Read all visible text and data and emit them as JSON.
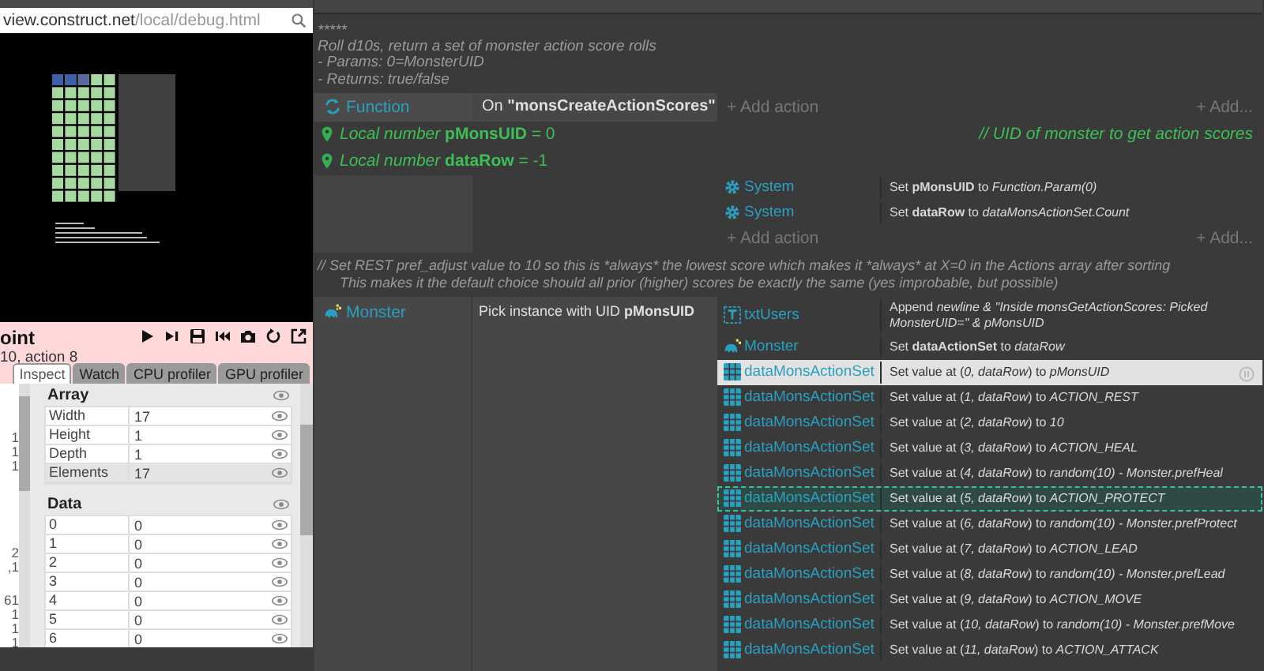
{
  "preview": {
    "address_host": "view.construct.net",
    "address_path": "/local/debug.html"
  },
  "debugger": {
    "title": "oint",
    "subtitle": "10, action 8",
    "tabs": [
      {
        "label": "Inspect",
        "selected": true
      },
      {
        "label": "Watch",
        "selected": false
      },
      {
        "label": "CPU profiler",
        "selected": false
      },
      {
        "label": "GPU profiler",
        "selected": false
      }
    ],
    "left_column": [
      [
        "1",
        "1",
        "1"
      ],
      [
        "2",
        ",1"
      ],
      [
        "61",
        "1",
        "1",
        "1"
      ]
    ],
    "sections": [
      {
        "title": "Array",
        "rows": [
          {
            "name": "Width",
            "value": "17",
            "selected": false
          },
          {
            "name": "Height",
            "value": "1",
            "selected": false
          },
          {
            "name": "Depth",
            "value": "1",
            "selected": false
          },
          {
            "name": "Elements",
            "value": "17",
            "selected": true
          }
        ]
      },
      {
        "title": "Data",
        "rows": [
          {
            "name": "0",
            "value": "0",
            "selected": false
          },
          {
            "name": "1",
            "value": "0",
            "selected": false
          },
          {
            "name": "2",
            "value": "0",
            "selected": false
          },
          {
            "name": "3",
            "value": "0",
            "selected": false
          },
          {
            "name": "4",
            "value": "0",
            "selected": false
          },
          {
            "name": "5",
            "value": "0",
            "selected": false
          },
          {
            "name": "6",
            "value": "0",
            "selected": false
          }
        ]
      }
    ]
  },
  "event_sheet": {
    "comment_top": [
      "*****",
      "Roll d10s, return a set of monster action score rolls",
      "- Params: 0=MonsterUID",
      "- Returns: true/false"
    ],
    "function_event": {
      "object": "Function",
      "condition": "On **\"monsCreateActionScores\"**",
      "add_action": "+ Add action",
      "add": "+ Add..."
    },
    "local_vars": [
      {
        "text": "*Local number* **pMonsUID** = 0",
        "comment": "//  UID of monster to get action scores"
      },
      {
        "text": "*Local number* **dataRow** = -1"
      }
    ],
    "sub_event": {
      "actions": [
        {
          "kind": "system",
          "object": "System",
          "text": "Set **pMonsUID** to *Function.Param(0)*"
        },
        {
          "kind": "system",
          "object": "System",
          "text": "Set **dataRow** to *dataMonsActionSet.Count*"
        }
      ],
      "add_action": "+ Add action",
      "add": "+ Add..."
    },
    "comment": [
      "//   Set REST pref_adjust value to 10 so this is *always* the lowest score which makes it *always* at X=0 in the Actions array after sorting",
      "This makes it the default choice should all prior (higher) scores be exactly the same (yes improbable, but possible)"
    ],
    "event": {
      "object": "Monster",
      "condition": "Pick instance with UID **pMonsUID**",
      "actions": [
        {
          "kind": "text",
          "object": "txtUsers",
          "text": "Append *newline & \"Inside monsGetActionScores: Picked MonsterUID=\" & pMonsUID*",
          "selected": false,
          "focused": false
        },
        {
          "kind": "sprite",
          "object": "Monster",
          "text": "Set **dataActionSet** to *dataRow*",
          "selected": false,
          "focused": false
        },
        {
          "kind": "array",
          "object": "dataMonsActionSet",
          "text": "Set value at (*0, dataRow*) to *pMonsUID*",
          "selected": true,
          "focused": false
        },
        {
          "kind": "array",
          "object": "dataMonsActionSet",
          "text": "Set value at (*1, dataRow*) to *ACTION_REST*",
          "selected": false,
          "focused": false
        },
        {
          "kind": "array",
          "object": "dataMonsActionSet",
          "text": "Set value at (*2, dataRow*) to *10*",
          "selected": false,
          "focused": false
        },
        {
          "kind": "array",
          "object": "dataMonsActionSet",
          "text": "Set value at (*3, dataRow*) to *ACTION_HEAL*",
          "selected": false,
          "focused": false
        },
        {
          "kind": "array",
          "object": "dataMonsActionSet",
          "text": "Set value at (*4, dataRow*) to *random(10) - Monster.prefHeal*",
          "selected": false,
          "focused": false
        },
        {
          "kind": "array",
          "object": "dataMonsActionSet",
          "text": "Set value at (*5, dataRow*) to *ACTION_PROTECT*",
          "selected": false,
          "focused": true
        },
        {
          "kind": "array",
          "object": "dataMonsActionSet",
          "text": "Set value at (*6, dataRow*) to *random(10) - Monster.prefProtect*",
          "selected": false,
          "focused": false
        },
        {
          "kind": "array",
          "object": "dataMonsActionSet",
          "text": "Set value at (*7, dataRow*) to *ACTION_LEAD*",
          "selected": false,
          "focused": false
        },
        {
          "kind": "array",
          "object": "dataMonsActionSet",
          "text": "Set value at (*8, dataRow*) to *random(10) - Monster.prefLead*",
          "selected": false,
          "focused": false
        },
        {
          "kind": "array",
          "object": "dataMonsActionSet",
          "text": "Set value at (*9, dataRow*) to *ACTION_MOVE*",
          "selected": false,
          "focused": false
        },
        {
          "kind": "array",
          "object": "dataMonsActionSet",
          "text": "Set value at (*10, dataRow*) to *random(10) - Monster.prefMove*",
          "selected": false,
          "focused": false
        },
        {
          "kind": "array",
          "object": "dataMonsActionSet",
          "text": "Set value at (*11, dataRow*) to *ACTION_ATTACK*",
          "selected": false,
          "focused": false
        }
      ]
    }
  }
}
